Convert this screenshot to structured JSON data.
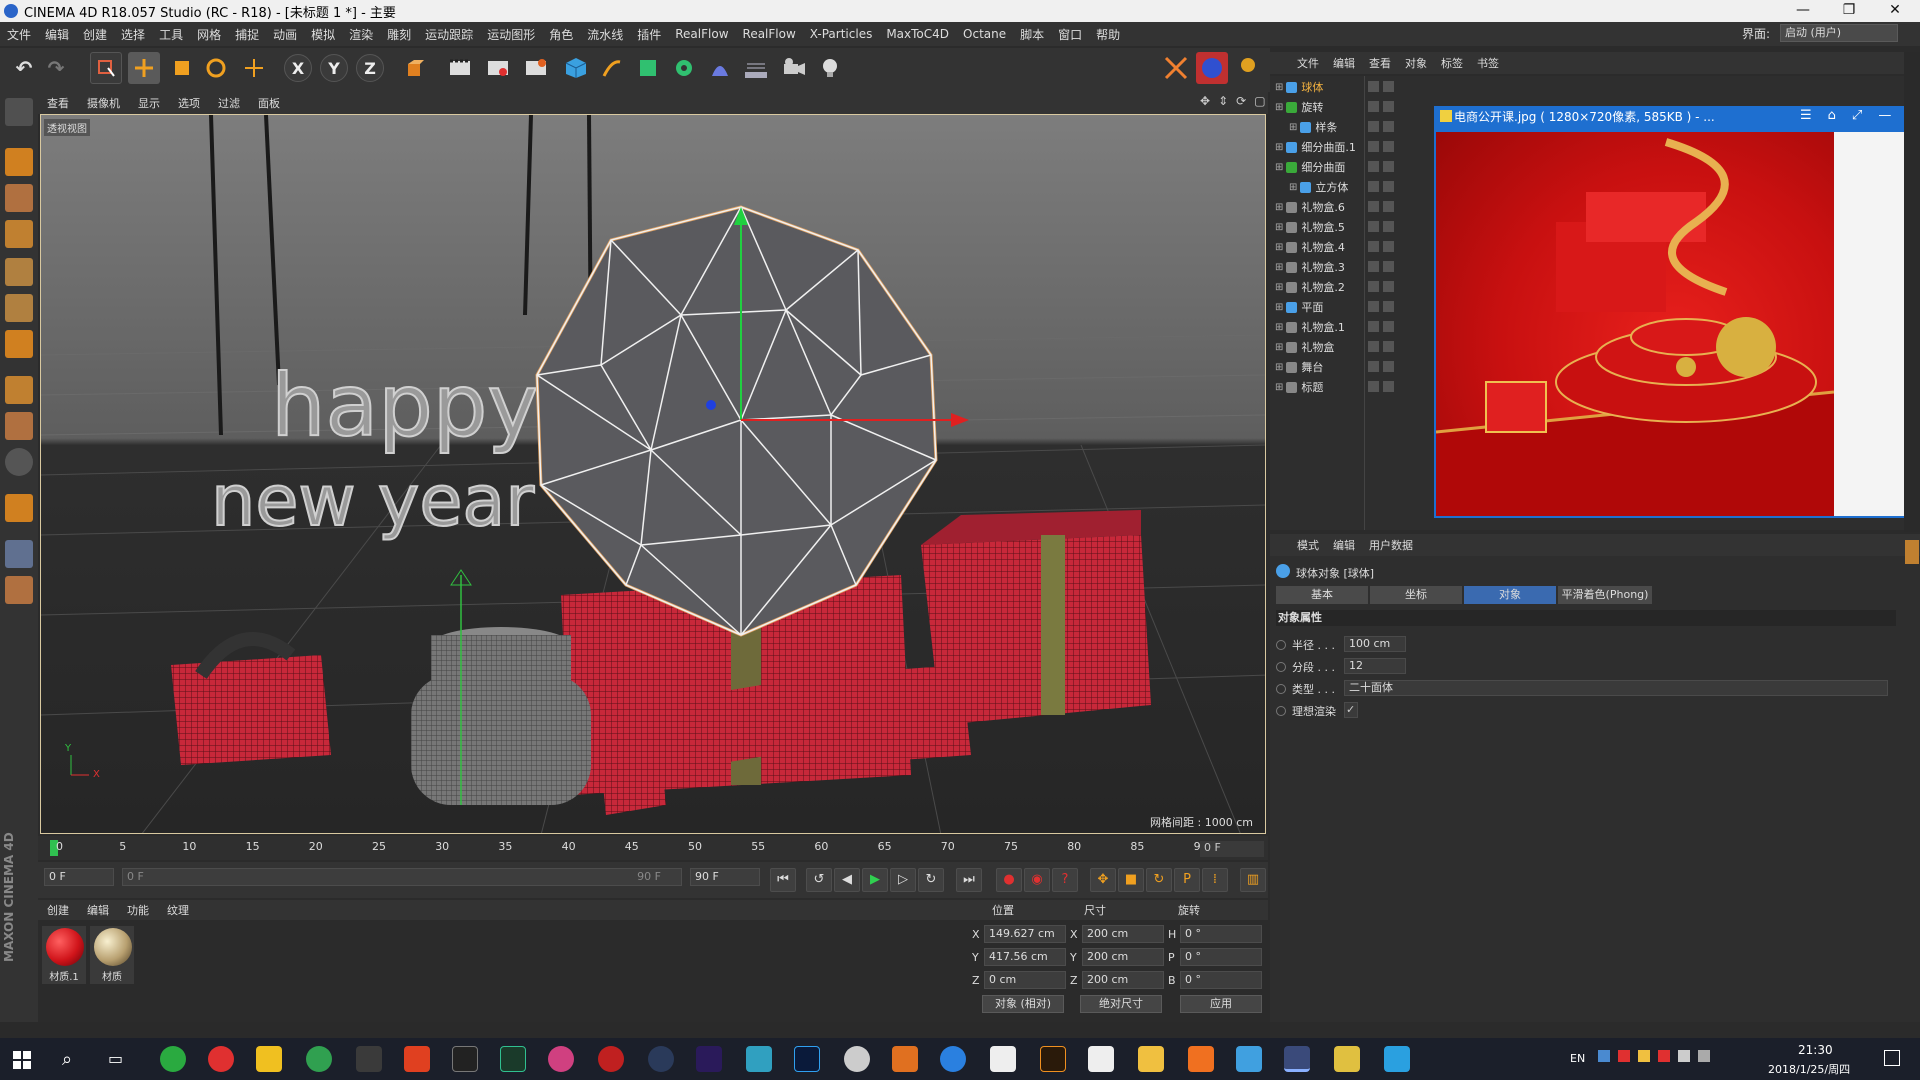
{
  "titlebar": {
    "title": "CINEMA 4D R18.057 Studio (RC - R18) - [未标题 1 *] - 主要",
    "min": "—",
    "max": "❐",
    "close": "✕"
  },
  "menubar": {
    "items": [
      "文件",
      "编辑",
      "创建",
      "选择",
      "工具",
      "网格",
      "捕捉",
      "动画",
      "模拟",
      "渲染",
      "雕刻",
      "运动跟踪",
      "运动图形",
      "角色",
      "流水线",
      "插件",
      "RealFlow",
      "RealFlow",
      "X-Particles",
      "MaxToC4D",
      "Octane",
      "脚本",
      "窗口",
      "帮助"
    ],
    "layout_label": "界面:",
    "layout_value": "启动 (用户)"
  },
  "viewport": {
    "menu": [
      "查看",
      "摄像机",
      "显示",
      "选项",
      "过滤",
      "面板"
    ],
    "label": "透视视图",
    "grid_info": "网格间距 : 1000 cm",
    "text_line1": "happy",
    "text_line2": "new year",
    "axis_y": "Y",
    "axis_x": "X"
  },
  "timeline": {
    "ticks": [
      "0",
      "5",
      "10",
      "15",
      "20",
      "25",
      "30",
      "35",
      "40",
      "45",
      "50",
      "55",
      "60",
      "65",
      "70",
      "75",
      "80",
      "85",
      "90"
    ],
    "current": "0 F"
  },
  "transport": {
    "start": "0 F",
    "range_start": "0 F",
    "range_end": "90 F",
    "end": "90 F"
  },
  "materials": {
    "menu": [
      "创建",
      "编辑",
      "功能",
      "纹理"
    ],
    "items": [
      {
        "name": "材质.1",
        "color": "#d0141a"
      },
      {
        "name": "材质",
        "color": "#b8a070"
      }
    ]
  },
  "coords": {
    "headers": [
      "位置",
      "尺寸",
      "旋转"
    ],
    "rows": [
      {
        "axis": "X",
        "pos": "149.627 cm",
        "size_axis": "X",
        "size": "200 cm",
        "rot_axis": "H",
        "rot": "0 °"
      },
      {
        "axis": "Y",
        "pos": "417.56 cm",
        "size_axis": "Y",
        "size": "200 cm",
        "rot_axis": "P",
        "rot": "0 °"
      },
      {
        "axis": "Z",
        "pos": "0 cm",
        "size_axis": "Z",
        "size": "200 cm",
        "rot_axis": "B",
        "rot": "0 °"
      }
    ],
    "mode": "对象 (相对)",
    "size_mode": "绝对尺寸",
    "apply": "应用"
  },
  "object_manager": {
    "menu": [
      "文件",
      "编辑",
      "查看",
      "对象",
      "标签",
      "书签"
    ],
    "objects": [
      {
        "name": "球体",
        "indent": 0,
        "color": "#4aa0e8",
        "active": true
      },
      {
        "name": "旋转",
        "indent": 0,
        "color": "#3aaa3a"
      },
      {
        "name": "样条",
        "indent": 1,
        "color": "#4aa0e8"
      },
      {
        "name": "细分曲面.1",
        "indent": 0,
        "color": "#4aa0e8"
      },
      {
        "name": "细分曲面",
        "indent": 0,
        "color": "#3aaa3a"
      },
      {
        "name": "立方体",
        "indent": 1,
        "color": "#4aa0e8"
      },
      {
        "name": "礼物盒.6",
        "indent": 0,
        "color": "#888888"
      },
      {
        "name": "礼物盒.5",
        "indent": 0,
        "color": "#888888"
      },
      {
        "name": "礼物盒.4",
        "indent": 0,
        "color": "#888888"
      },
      {
        "name": "礼物盒.3",
        "indent": 0,
        "color": "#888888"
      },
      {
        "name": "礼物盒.2",
        "indent": 0,
        "color": "#888888"
      },
      {
        "name": "平面",
        "indent": 0,
        "color": "#4aa0e8"
      },
      {
        "name": "礼物盒.1",
        "indent": 0,
        "color": "#888888"
      },
      {
        "name": "礼物盒",
        "indent": 0,
        "color": "#888888"
      },
      {
        "name": "舞台",
        "indent": 0,
        "color": "#888888"
      },
      {
        "name": "标题",
        "indent": 0,
        "color": "#888888"
      }
    ]
  },
  "image_viewer": {
    "title": "电商公开课.jpg ( 1280×720像素, 585KB ) - ..."
  },
  "attributes": {
    "menu": [
      "模式",
      "编辑",
      "用户数据"
    ],
    "object_title": "球体对象 [球体]",
    "tabs": [
      "基本",
      "坐标",
      "对象",
      "平滑着色(Phong)"
    ],
    "active_tab": "对象",
    "section": "对象属性",
    "props": [
      {
        "label": "半径 . . .",
        "value": "100 cm"
      },
      {
        "label": "分段 . . .",
        "value": "12"
      },
      {
        "label": "类型 . . .",
        "value": "二十面体"
      },
      {
        "label": "理想渲染",
        "value": "✓"
      }
    ]
  },
  "brand": "MAXON CINEMA 4D",
  "taskbar": {
    "time": "21:30",
    "date": "2018/1/25/周四",
    "ime": "EN"
  }
}
